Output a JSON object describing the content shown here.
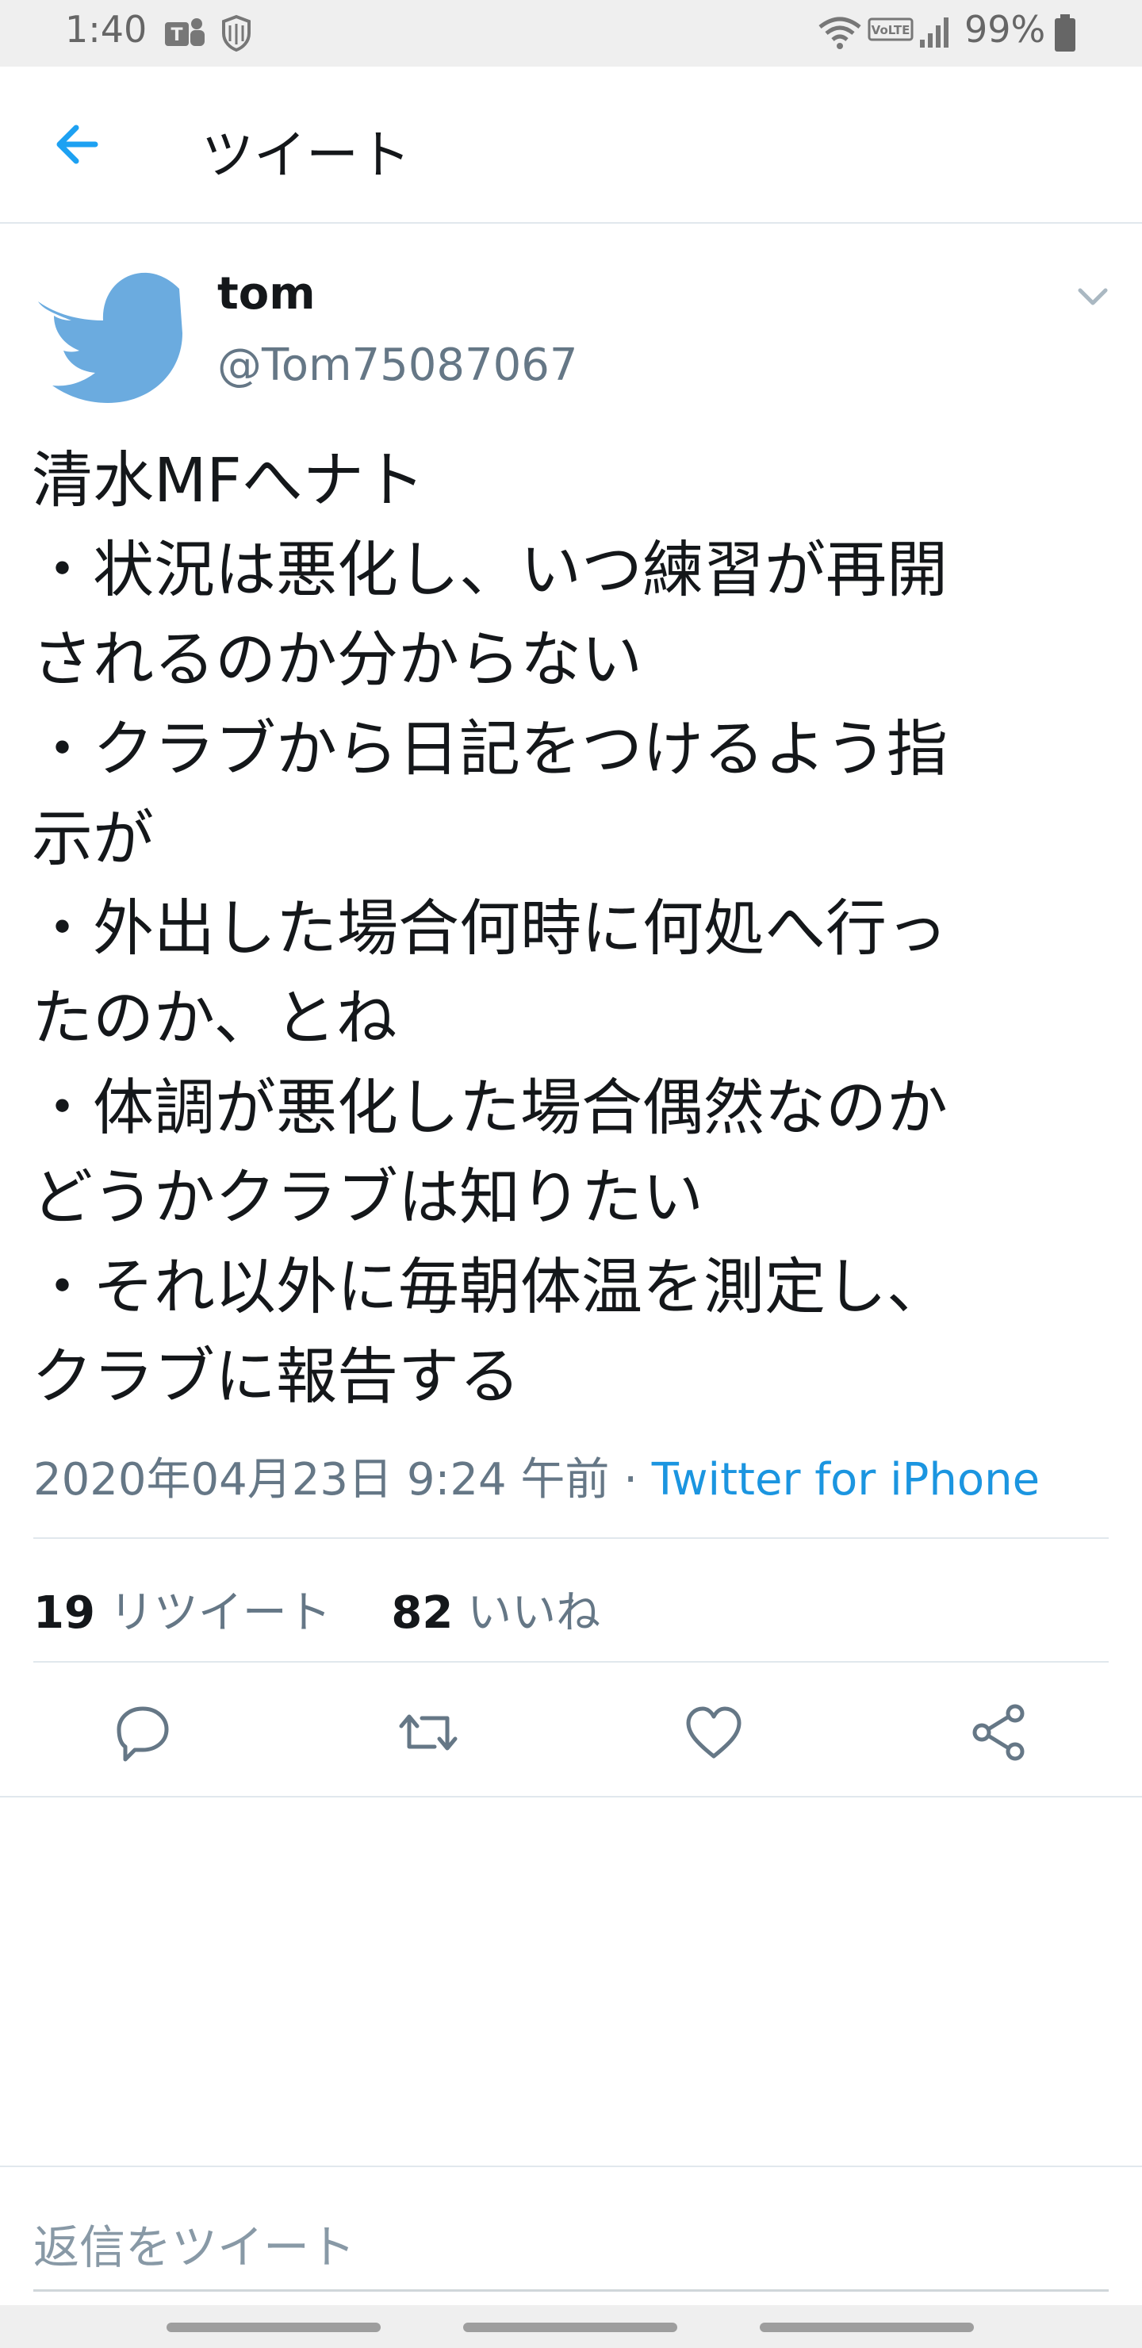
{
  "status_bar": {
    "time": "1:40",
    "battery": "99%",
    "icons": [
      "teams-icon",
      "shield-icon",
      "wifi-icon",
      "volte-icon",
      "signal-icon",
      "battery-icon"
    ]
  },
  "header": {
    "title": "ツイート",
    "back_icon": "arrow-left-icon",
    "accent_color": "#1da1f2"
  },
  "tweet": {
    "author_name": "tom",
    "author_handle": "@Tom75087067",
    "text_lines": [
      "清水MFへナト",
      "・状況は悪化し、いつ練習が再開",
      "されるのか分からない",
      "・クラブから日記をつけるよう指",
      "示が",
      "・外出した場合何時に何処へ行っ",
      "たのか、とね",
      "・体調が悪化した場合偶然なのか",
      "どうかクラブは知りたい",
      "・それ以外に毎朝体温を測定し、",
      "クラブに報告する"
    ],
    "timestamp": "2020年04月23日 9:24 午前",
    "separator": " · ",
    "source": "Twitter for iPhone",
    "retweet_count": "19",
    "retweet_label": "リツイート",
    "like_count": "82",
    "like_label": "いいね"
  },
  "actions": {
    "icons": [
      "reply-icon",
      "retweet-icon",
      "like-icon",
      "share-icon"
    ]
  },
  "reply": {
    "placeholder": "返信をツイート"
  }
}
